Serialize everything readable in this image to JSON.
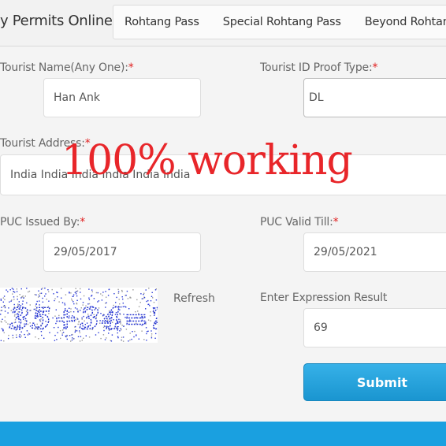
{
  "header": {
    "brand": "y Permits Online",
    "tabs": [
      "Rohtang Pass",
      "Special Rohtang Pass",
      "Beyond Rohtang"
    ]
  },
  "form": {
    "tourist_name_label": "Tourist Name(Any One):",
    "tourist_name_value": "Han Ank",
    "id_proof_label": "Tourist ID Proof Type:",
    "id_proof_value": "DL",
    "address_label": "Tourist Address:",
    "address_value": "India India India India India India",
    "puc_issued_label": "PUC Issued By:",
    "puc_issued_value": "29/05/2017",
    "puc_valid_label": "PUC Valid Till:",
    "puc_valid_value": "29/05/2021",
    "required_mark": "*",
    "captcha_text": "35+34=?",
    "refresh_label": "Refresh",
    "expression_label": "Enter Expression Result",
    "expression_value": "69",
    "submit_label": "Submit"
  },
  "overlay_text": "100% working",
  "colors": {
    "accent": "#1aa0e0",
    "required": "#e02020",
    "overlay": "#e8262a",
    "captcha_ink": "#1f2fd0"
  }
}
